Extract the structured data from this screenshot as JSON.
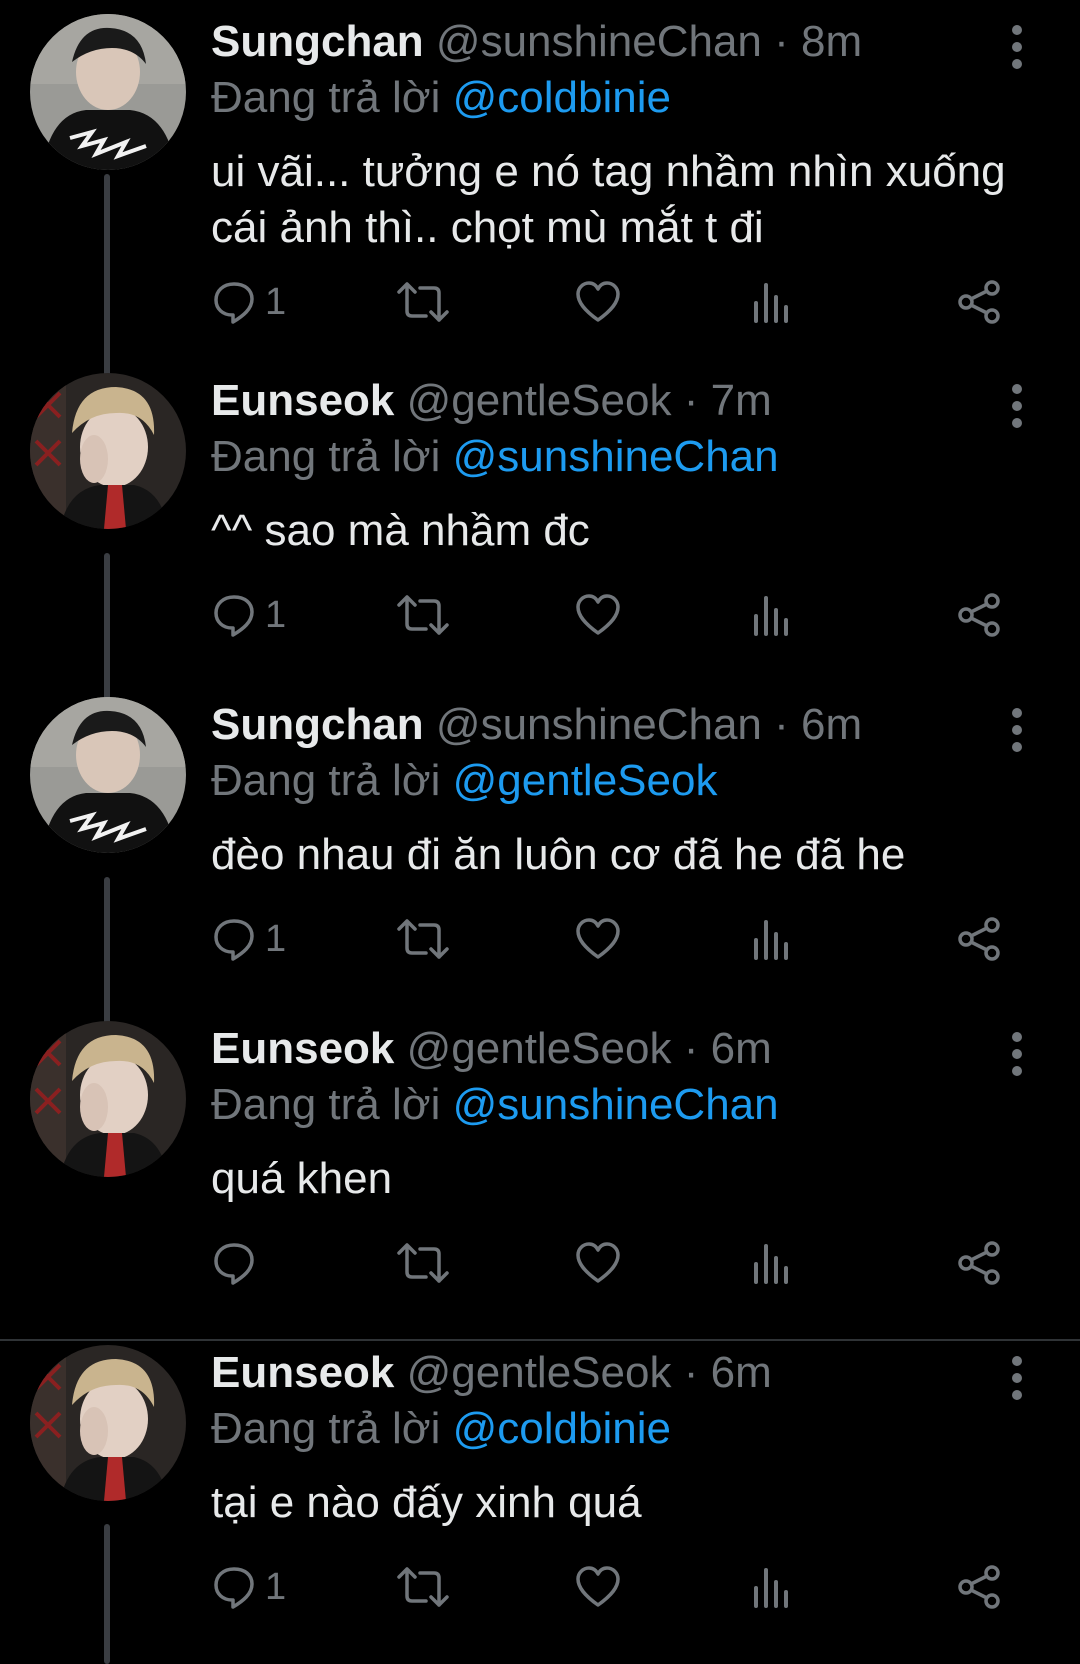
{
  "colors": {
    "background": "#000000",
    "text": "#e7e9ea",
    "secondary": "#71767b",
    "link": "#1d9bf0",
    "thread_line": "#3a3d42"
  },
  "tweets": [
    {
      "name": "Sungchan",
      "handle": "@sunshineChan",
      "separator": "·",
      "time": "8m",
      "replying_prefix": "Đang trả lời",
      "replying_to": "@coldbinie",
      "text": "ui vãi... tưởng e nó tag nhầm nhìn xuống cái ảnh thì.. chọt mù mắt t đi",
      "reply_count": "1"
    },
    {
      "name": "Eunseok",
      "handle": "@gentleSeok",
      "separator": "·",
      "time": "7m",
      "replying_prefix": "Đang trả lời",
      "replying_to": "@sunshineChan",
      "text": "^^ sao mà nhầm đc",
      "reply_count": "1"
    },
    {
      "name": "Sungchan",
      "handle": "@sunshineChan",
      "separator": "·",
      "time": "6m",
      "replying_prefix": "Đang trả lời",
      "replying_to": "@gentleSeok",
      "text": "đèo nhau đi ăn luôn cơ đã he đã he",
      "reply_count": "1"
    },
    {
      "name": "Eunseok",
      "handle": "@gentleSeok",
      "separator": "·",
      "time": "6m",
      "replying_prefix": "Đang trả lời",
      "replying_to": "@sunshineChan",
      "text": "quá khen",
      "reply_count": ""
    },
    {
      "name": "Eunseok",
      "handle": "@gentleSeok",
      "separator": "·",
      "time": "6m",
      "replying_prefix": "Đang trả lời",
      "replying_to": "@coldbinie",
      "text": "tại e nào đấy xinh quá",
      "reply_count": "1"
    }
  ],
  "icons": {
    "reply": "reply-icon",
    "retweet": "retweet-icon",
    "like": "heart-icon",
    "views": "views-icon",
    "share": "share-icon",
    "more": "more-vertical-icon"
  }
}
